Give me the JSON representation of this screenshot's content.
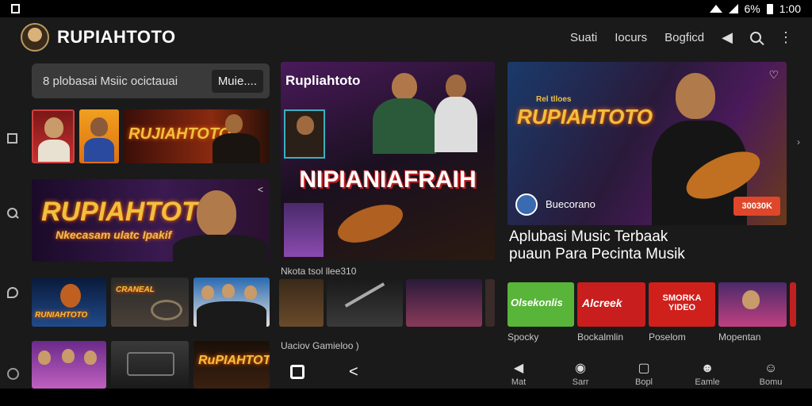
{
  "status": {
    "battery": "6%",
    "time": "1:00"
  },
  "header": {
    "brand": "RUPIAHTOTO",
    "nav": [
      "Suati",
      "Iocurs",
      "Bogficd"
    ]
  },
  "search": {
    "text": "8 plobasai Msiic ocictauai",
    "button": "Muie...."
  },
  "row1": {
    "art_title": "RUJIAHTOTO"
  },
  "banner_left": {
    "title": "RUPIAHTOTO",
    "subtitle": "Nkecasam ulatc Ipakif"
  },
  "center_feature": {
    "top_label": "Rupliahtoto",
    "big_title": "NIPIANIAFRAIH"
  },
  "right_feature": {
    "small_label": "Rel tlloes",
    "title": "RUPIAHTOTO",
    "channel": "Buecorano",
    "cta": "30030K",
    "headline_1": "Aplubasi Music Terbaak",
    "headline_2": "puaun Para Pecinta Musik"
  },
  "row3_left": [
    {
      "label": "RUNIAHTOTO"
    },
    {
      "label": "CRANEAL"
    },
    {
      "label": ""
    }
  ],
  "center_caption": "Nkota tsol llee310",
  "center_caption_2": "Uaciov   Gamieloo )",
  "bottom_left_art": "RuPIAHTOTO",
  "tiles": [
    {
      "art": "Olsekonlis",
      "label": "Spocky",
      "color": "#59b43a"
    },
    {
      "art": "Alcreek",
      "label": "Bockalmlin",
      "color": "#c81e1e"
    },
    {
      "art": "SMORKA YIDEO",
      "label": "Poselom",
      "color": "#d0201c"
    },
    {
      "art": "",
      "label": "Mopentan",
      "color": "#4a2a6a"
    }
  ],
  "bottom_nav": [
    {
      "icon": "flag-icon",
      "label": "Mat"
    },
    {
      "icon": "disc-icon",
      "label": "Sarr"
    },
    {
      "icon": "square-icon",
      "label": "Bopl"
    },
    {
      "icon": "person-icon",
      "label": "Eamle"
    },
    {
      "icon": "profile-icon",
      "label": "Bomu"
    }
  ],
  "colors": {
    "background": "#1a1a1a",
    "accent": "#e0462a",
    "gold": "#f0c040"
  }
}
